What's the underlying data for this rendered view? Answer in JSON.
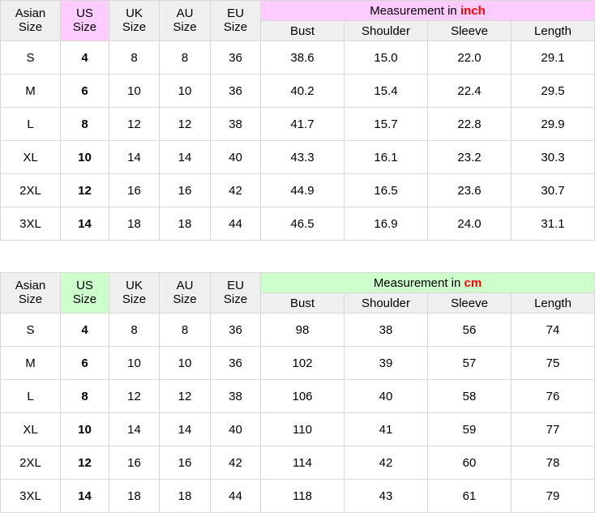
{
  "tables": [
    {
      "id": "inch-table",
      "accent_color": "#ffccff",
      "unit_color": "#ff0000",
      "measurement_label_prefix": "Measurement in ",
      "measurement_unit": "inch",
      "size_headers": [
        {
          "line1": "Asian",
          "line2": "Size"
        },
        {
          "line1": "US",
          "line2": "Size"
        },
        {
          "line1": "UK",
          "line2": "Size"
        },
        {
          "line1": "AU",
          "line2": "Size"
        },
        {
          "line1": "EU",
          "line2": "Size"
        }
      ],
      "measurement_headers": [
        "Bust",
        "Shoulder",
        "Sleeve",
        "Length"
      ],
      "rows": [
        {
          "asian": "S",
          "us": "4",
          "uk": "8",
          "au": "8",
          "eu": "36",
          "bust": "38.6",
          "shoulder": "15.0",
          "sleeve": "22.0",
          "length": "29.1"
        },
        {
          "asian": "M",
          "us": "6",
          "uk": "10",
          "au": "10",
          "eu": "36",
          "bust": "40.2",
          "shoulder": "15.4",
          "sleeve": "22.4",
          "length": "29.5"
        },
        {
          "asian": "L",
          "us": "8",
          "uk": "12",
          "au": "12",
          "eu": "38",
          "bust": "41.7",
          "shoulder": "15.7",
          "sleeve": "22.8",
          "length": "29.9"
        },
        {
          "asian": "XL",
          "us": "10",
          "uk": "14",
          "au": "14",
          "eu": "40",
          "bust": "43.3",
          "shoulder": "16.1",
          "sleeve": "23.2",
          "length": "30.3"
        },
        {
          "asian": "2XL",
          "us": "12",
          "uk": "16",
          "au": "16",
          "eu": "42",
          "bust": "44.9",
          "shoulder": "16.5",
          "sleeve": "23.6",
          "length": "30.7"
        },
        {
          "asian": "3XL",
          "us": "14",
          "uk": "18",
          "au": "18",
          "eu": "44",
          "bust": "46.5",
          "shoulder": "16.9",
          "sleeve": "24.0",
          "length": "31.1"
        }
      ]
    },
    {
      "id": "cm-table",
      "accent_color": "#ccffcc",
      "unit_color": "#ff0000",
      "measurement_label_prefix": "Measurement in ",
      "measurement_unit": "cm",
      "size_headers": [
        {
          "line1": "Asian",
          "line2": "Size"
        },
        {
          "line1": "US",
          "line2": "Size"
        },
        {
          "line1": "UK",
          "line2": "Size"
        },
        {
          "line1": "AU",
          "line2": "Size"
        },
        {
          "line1": "EU",
          "line2": "Size"
        }
      ],
      "measurement_headers": [
        "Bust",
        "Shoulder",
        "Sleeve",
        "Length"
      ],
      "rows": [
        {
          "asian": "S",
          "us": "4",
          "uk": "8",
          "au": "8",
          "eu": "36",
          "bust": "98",
          "shoulder": "38",
          "sleeve": "56",
          "length": "74"
        },
        {
          "asian": "M",
          "us": "6",
          "uk": "10",
          "au": "10",
          "eu": "36",
          "bust": "102",
          "shoulder": "39",
          "sleeve": "57",
          "length": "75"
        },
        {
          "asian": "L",
          "us": "8",
          "uk": "12",
          "au": "12",
          "eu": "38",
          "bust": "106",
          "shoulder": "40",
          "sleeve": "58",
          "length": "76"
        },
        {
          "asian": "XL",
          "us": "10",
          "uk": "14",
          "au": "14",
          "eu": "40",
          "bust": "110",
          "shoulder": "41",
          "sleeve": "59",
          "length": "77"
        },
        {
          "asian": "2XL",
          "us": "12",
          "uk": "16",
          "au": "16",
          "eu": "42",
          "bust": "114",
          "shoulder": "42",
          "sleeve": "60",
          "length": "78"
        },
        {
          "asian": "3XL",
          "us": "14",
          "uk": "18",
          "au": "18",
          "eu": "44",
          "bust": "118",
          "shoulder": "43",
          "sleeve": "61",
          "length": "79"
        }
      ]
    }
  ]
}
